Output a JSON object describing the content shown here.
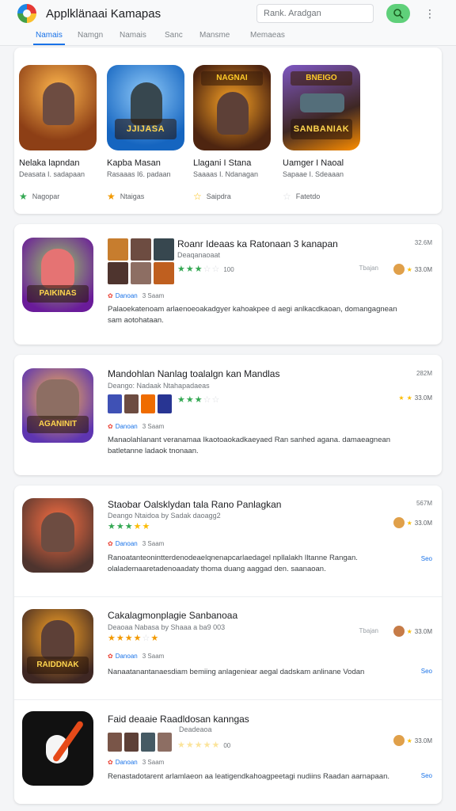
{
  "header": {
    "title": "Applklänaai Kamapas",
    "search_placeholder": "Rank. Aradgan",
    "search_icon": "search-icon",
    "menu_icon": "more-vert-icon"
  },
  "tabs": [
    {
      "label": "Namais"
    },
    {
      "label": "Namgn"
    },
    {
      "label": "Namais"
    },
    {
      "label": "Sanc"
    },
    {
      "label": "Mansme"
    },
    {
      "label": "Memaeas"
    }
  ],
  "featured": [
    {
      "name": "Nelaka lapndan",
      "sub": "Deasata I. sadapaan",
      "meta": "Nagopar",
      "star": "#34a853",
      "banner": "",
      "top": ""
    },
    {
      "name": "Kapba Masan",
      "sub": "Rasaaas I6. padaan",
      "meta": "Ntaigas",
      "star": "#f29900",
      "banner": "JJIJASA",
      "top": ""
    },
    {
      "name": "Llagani I Stana",
      "sub": "Saaaas I. Ndanagan",
      "meta": "Saipdra",
      "star": "#fbbc04",
      "banner": "",
      "top": "NAGNAI"
    },
    {
      "name": "Uamger I Naoal",
      "sub": "Sapaae I. Sdeaaan",
      "meta": "Fatetdo",
      "star": "#dadce0",
      "banner": "SANBANIAK",
      "top": "BNEIGO"
    }
  ],
  "apps": [
    {
      "title": "Roanr Ideaas ka Ratonaan 3 kanapan",
      "sub": "Deaqanaoaat",
      "size": "32.6M",
      "dl": "33.0M",
      "tag": "Tbajan",
      "rating_count": "100",
      "publisher": "Danoan",
      "time": "3 Saam",
      "desc": "Palaoekatenoam arlaenoeoakadgyer kahoakpee d aegi anlkacdkaoan, domangagnean sam aotohataan.",
      "banner": "PAIKINAS",
      "filled": 3,
      "star_color": "#34a853",
      "more": ""
    },
    {
      "title": "Mandohlan Nanlag toalalgn kan Mandlas",
      "sub": "Deango:  Nadaak  Ntahapadaeas",
      "size": "282M",
      "dl": "33.0M",
      "tag": "",
      "rating_count": "",
      "publisher": "Danoan",
      "time": "3 Saam",
      "desc": "Manaolahlanant veranamaa Ikaotoaokadkaeyaed Ran sanhed agana. damaeagnean batletanne ladaok tnonaan.",
      "banner": "AGANINIT",
      "filled": 3,
      "star_color": "#34a853",
      "more": ""
    },
    {
      "title": "Staobar Oalsklydan tala Rano Panlagkan",
      "sub": "Deango  Ntaidoa  by Sadak daoagg2",
      "size": "567M",
      "dl": "33.0M",
      "tag": "",
      "rating_count": "",
      "publisher": "Danoan",
      "time": "3 Saam",
      "desc": "Ranoatanteonintterdenodeaelqnenapcarlaedagel npllalakh Iltanne Rangan. olalademaaretadenoaadaty thoma duang aaggad den. saanaoan.",
      "banner": "",
      "filled": 5,
      "star_color": "#34a853",
      "more": "Seo"
    },
    {
      "title": "Cakalagmonplagie Sanbanoaa",
      "sub": "Deaoaa  Nabasa  by Shaaa a ba9 003",
      "size": "",
      "dl": "33.0M",
      "tag": "Tbajan",
      "rating_count": "",
      "publisher": "Danoan",
      "time": "3 Saam",
      "desc": "Nanaatanantanaesdiam bemiing anlageniear aegal dadskam anlinane Vodan",
      "banner": "RAIDDNAK",
      "filled": 5,
      "star_color": "#f29900",
      "more": "Seo"
    },
    {
      "title": "Faid deaaie   Raadldosan kanngas",
      "sub": "Deadeaoa",
      "size": "",
      "dl": "33.0M",
      "tag": "",
      "rating_count": "00",
      "publisher": "Danoan",
      "time": "3 Saam",
      "desc": "Renastadotarent arlamlaeon aa leatigendkahoagpeetagi nudiins Raadan aarnapaan.",
      "banner": "",
      "filled": 5,
      "star_color": "#fbbc04",
      "more": "Seo"
    }
  ]
}
